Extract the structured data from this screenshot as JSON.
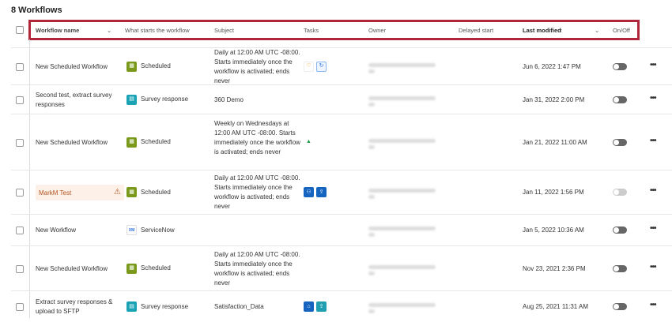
{
  "title": "8 Workflows",
  "columns": {
    "name": "Workflow name",
    "trigger": "What starts the workflow",
    "subject": "Subject",
    "tasks": "Tasks",
    "owner": "Owner",
    "delayed": "Delayed start",
    "modified": "Last modified",
    "onoff": "On/Off"
  },
  "sort_arrow": "↑",
  "rows": [
    {
      "name": "New Scheduled Workflow",
      "trigger": "Scheduled",
      "subject": "Daily at 12:00 AM UTC -08:00. Starts immediately once the workflow is activated; ends never",
      "modified": "Jun 6, 2022 1:47 PM",
      "enabled": false
    },
    {
      "name": "Second test, extract survey responses",
      "trigger": "Survey response",
      "subject": "360 Demo",
      "modified": "Jan 31, 2022 2:00 PM",
      "enabled": false
    },
    {
      "name": "New Scheduled Workflow",
      "trigger": "Scheduled",
      "subject": "Weekly on Wednesdays at 12:00 AM UTC -08:00. Starts immediately once the workflow is activated; ends never",
      "modified": "Jan 21, 2022 11:00 AM",
      "enabled": false
    },
    {
      "name": "MarkM Test",
      "trigger": "Scheduled",
      "subject": "Daily at 12:00 AM UTC -08:00. Starts immediately once the workflow is activated; ends never",
      "modified": "Jan 11, 2022 1:56 PM",
      "enabled": false,
      "warning": true
    },
    {
      "name": "New Workflow",
      "trigger": "ServiceNow",
      "trigger_logo": "XM",
      "subject": "",
      "modified": "Jan 5, 2022 10:36 AM",
      "enabled": false
    },
    {
      "name": "New Scheduled Workflow",
      "trigger": "Scheduled",
      "subject": "Daily at 12:00 AM UTC -08:00. Starts immediately once the workflow is activated; ends never",
      "modified": "Nov 23, 2021 2:36 PM",
      "enabled": false
    },
    {
      "name": "Extract survey responses & upload to SFTP",
      "trigger": "Survey response",
      "subject": "Satisfaction_Data",
      "modified": "Aug 25, 2021 11:31 AM",
      "enabled": false
    }
  ],
  "colors": {
    "highlight": "#b0263a",
    "scheduled": "#7b9a1c",
    "survey": "#19a3b5"
  }
}
